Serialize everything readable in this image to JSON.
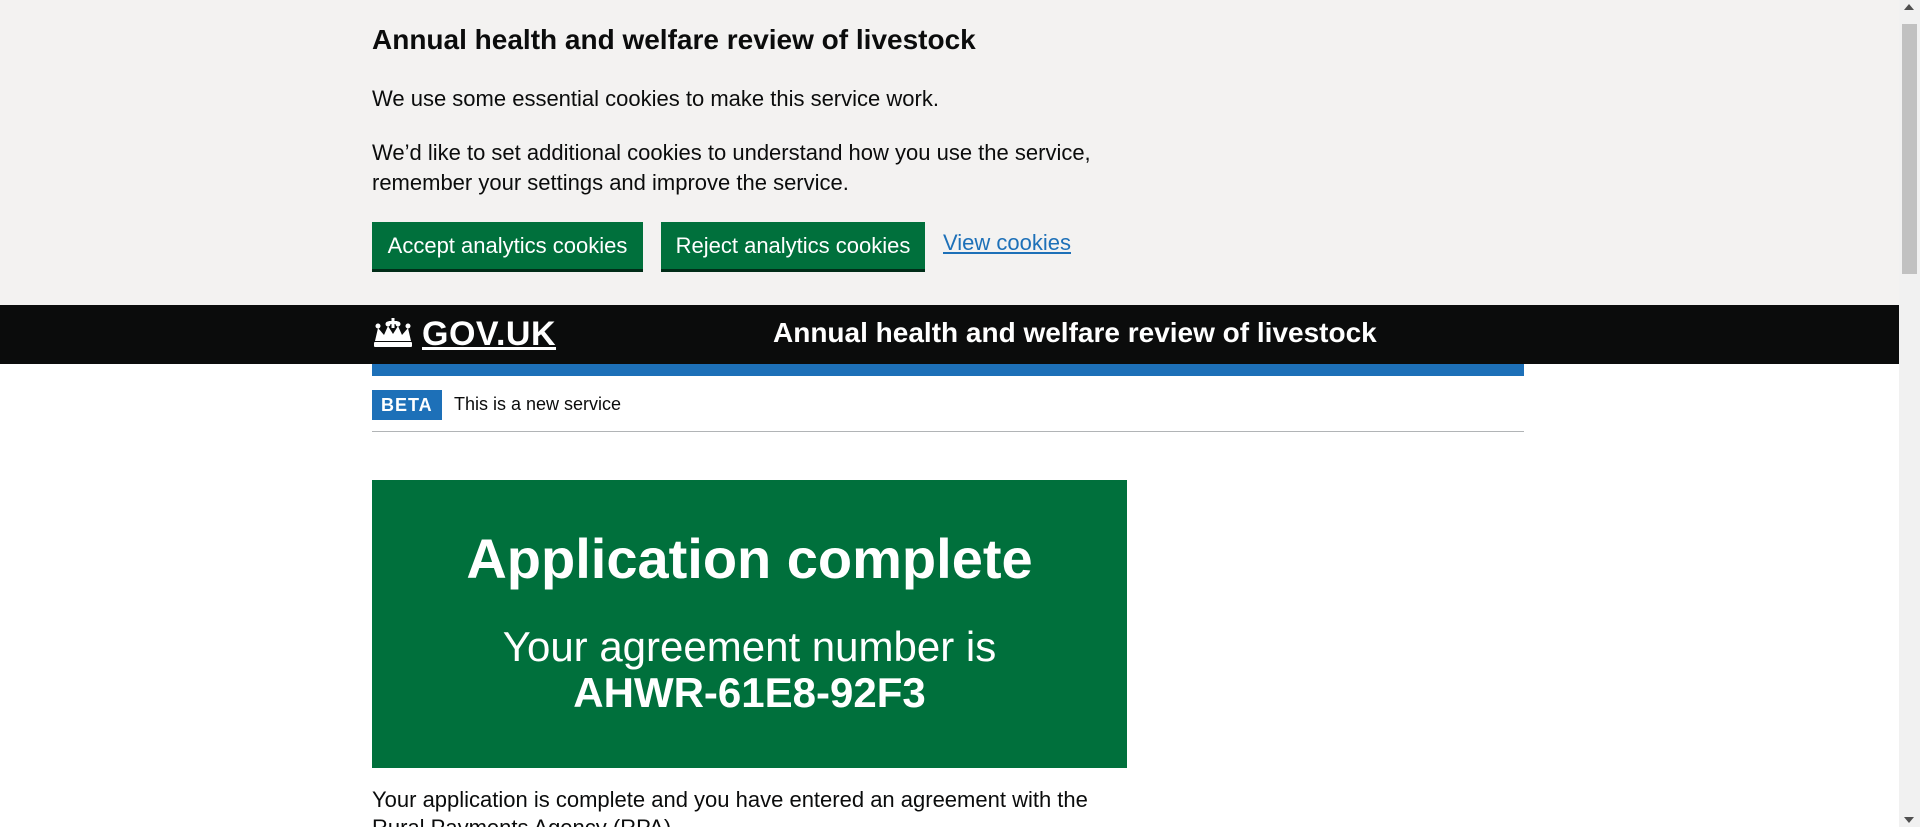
{
  "cookie_banner": {
    "title": "Annual health and welfare review of livestock",
    "paragraph1": "We use some essential cookies to make this service work.",
    "paragraph2": "We’d like to set additional cookies to understand how you use the service, remember your settings and improve the service.",
    "accept_label": "Accept analytics cookies",
    "reject_label": "Reject analytics cookies",
    "view_label": "View cookies"
  },
  "header": {
    "logo_text": "GOV.UK",
    "logo_icon": "crown-icon",
    "service_name": "Annual health and welfare review of livestock"
  },
  "phase_banner": {
    "tag": "BETA",
    "text": "This is a new service"
  },
  "panel": {
    "title": "Application complete",
    "body_prefix": "Your agreement number is",
    "agreement_number": "AHWR-61E8-92F3"
  },
  "body": {
    "text": "Your application is complete and you have entered an agreement with the Rural Payments Agency (RPA)."
  },
  "colors": {
    "cookie_bg": "#f3f2f1",
    "button_green": "#00703c",
    "link_blue": "#1d70b8",
    "header_black": "#0b0c0c",
    "panel_green": "#00703c"
  }
}
